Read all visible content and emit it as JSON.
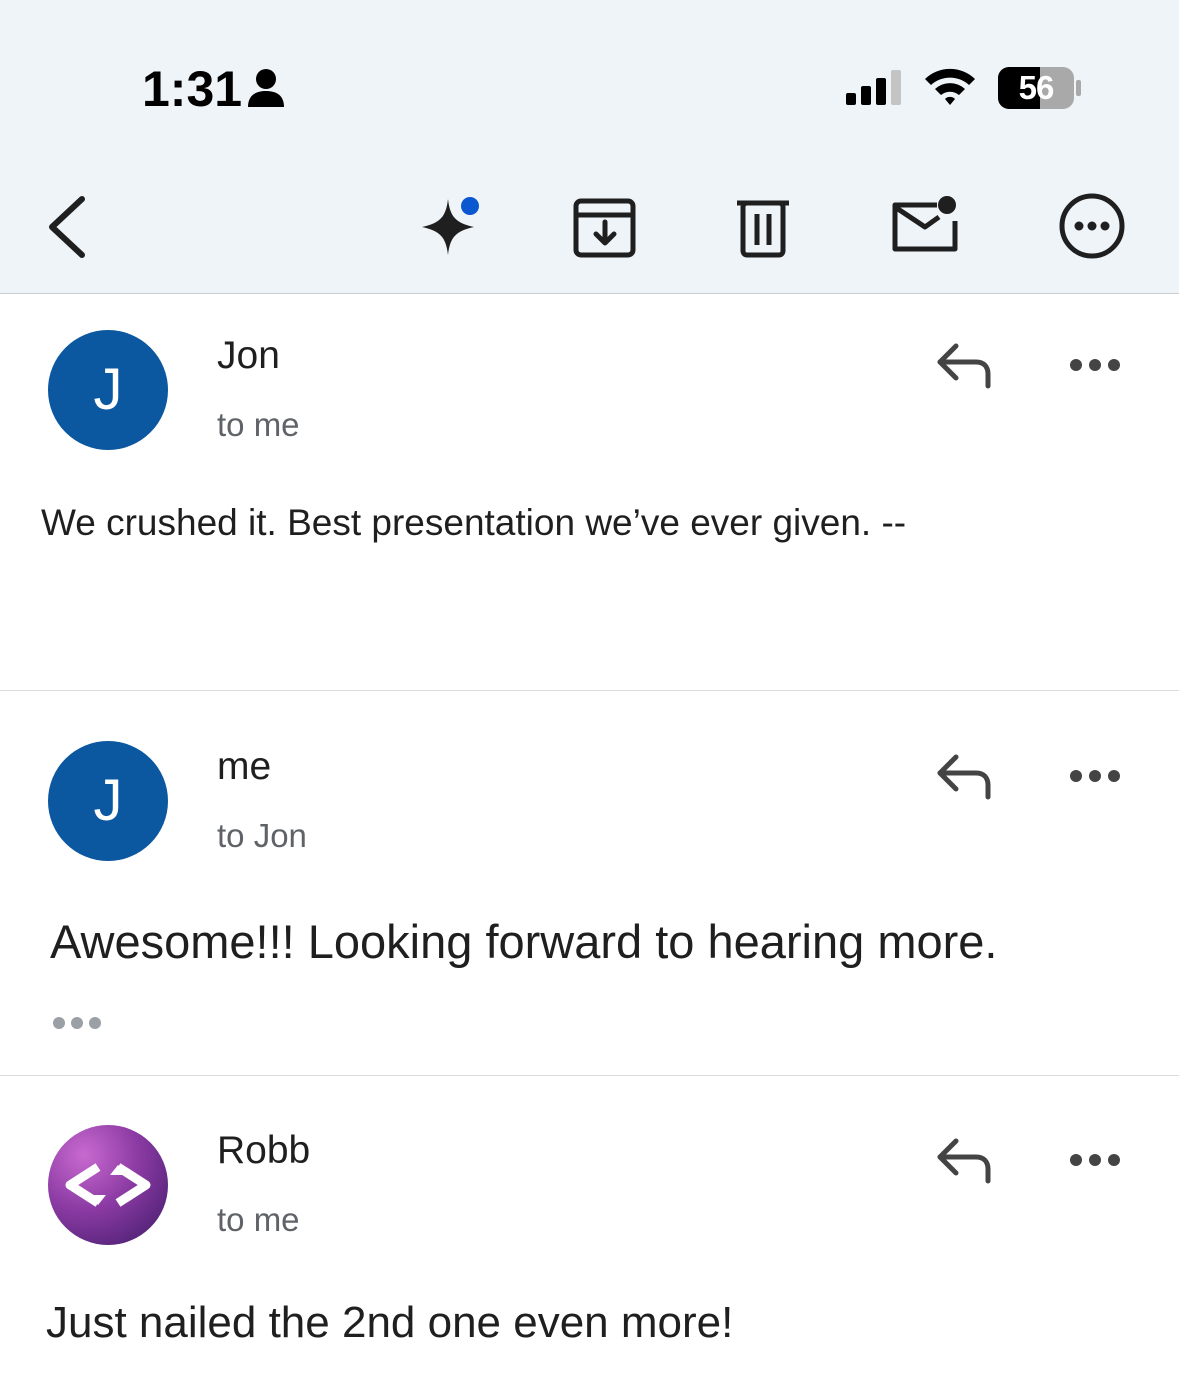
{
  "status_bar": {
    "time": "1:31",
    "battery": "56",
    "person_icon": "person-icon",
    "signal_icon": "cellular-signal-icon",
    "wifi_icon": "wifi-icon"
  },
  "toolbar": {
    "back_icon": "chevron-left-icon",
    "gemini_icon": "sparkle-icon",
    "archive_icon": "archive-icon",
    "delete_icon": "trash-icon",
    "mark_unread_icon": "mail-unread-icon",
    "more_icon": "more-horizontal-circle-icon"
  },
  "messages": [
    {
      "sender": "Jon",
      "recipient": "to me",
      "avatar_letter": "J",
      "avatar_color": "#0b57a0",
      "body": "We crushed it. Best presentation we’ve ever given. --"
    },
    {
      "sender": "me",
      "recipient": "to Jon",
      "avatar_letter": "J",
      "avatar_color": "#0b57a0",
      "body": "Awesome!!! Looking forward to hearing more."
    },
    {
      "sender": "Robb",
      "recipient": "to me",
      "avatar_icon": "code-brackets-logo-icon",
      "body": "Just nailed the 2nd one even more!"
    }
  ]
}
